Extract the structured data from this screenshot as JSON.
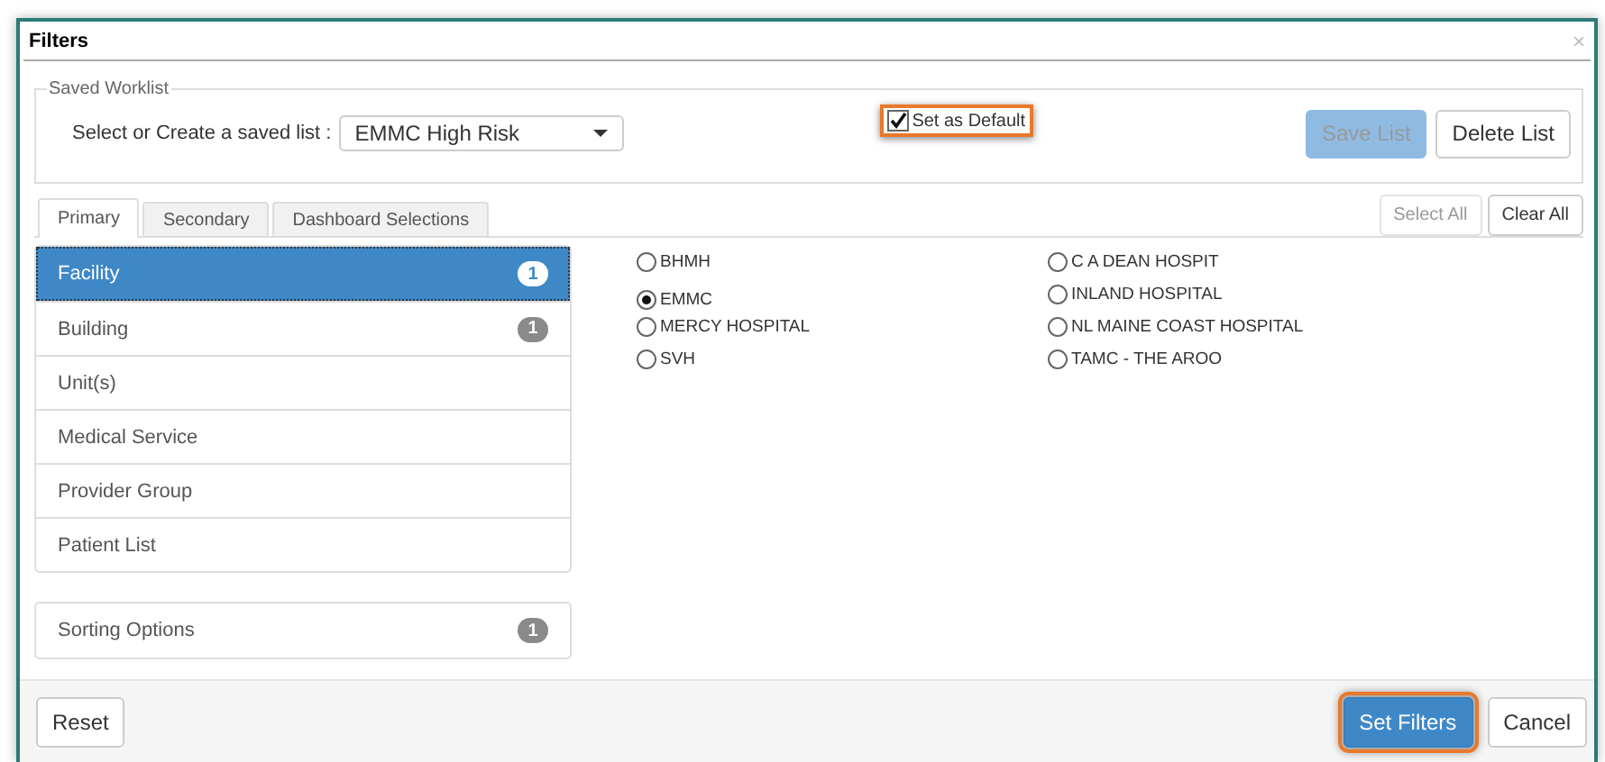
{
  "dialog": {
    "title": "Filters",
    "close": "×"
  },
  "saved_worklist": {
    "legend": "Saved Worklist",
    "label": "Select or Create a saved list :",
    "value": "EMMC High Risk",
    "set_default": {
      "label": "Set as Default",
      "checked": true,
      "highlighted": true
    },
    "buttons": [
      {
        "label": "Save List",
        "kind": "primary",
        "disabled": true
      },
      {
        "label": "Delete List",
        "kind": "default",
        "disabled": false
      }
    ]
  },
  "tabs": [
    {
      "label": "Primary",
      "selected": true
    },
    {
      "label": "Secondary",
      "selected": false
    },
    {
      "label": "Dashboard Selections",
      "selected": false
    }
  ],
  "tab_buttons": [
    {
      "label": "Select All",
      "disabled": true
    },
    {
      "label": "Clear All",
      "disabled": false
    }
  ],
  "categories": [
    {
      "label": "Facility",
      "badge": "1",
      "selected": true
    },
    {
      "label": "Building",
      "badge": "1",
      "selected": false
    },
    {
      "label": "Unit(s)",
      "selected": false
    },
    {
      "label": "Medical Service",
      "selected": false
    },
    {
      "label": "Provider Group",
      "selected": false
    },
    {
      "label": "Patient List",
      "selected": false
    }
  ],
  "sorting": {
    "label": "Sorting Options",
    "badge": "1"
  },
  "option_columns": [
    [
      {
        "label": "BHMH",
        "selected": false
      },
      {
        "label": "EMMC",
        "selected": true
      },
      {
        "label": "MERCY HOSPITAL",
        "selected": false
      },
      {
        "label": "SVH",
        "selected": false
      }
    ],
    [
      {
        "label": "C A DEAN HOSPIT",
        "selected": false
      },
      {
        "label": "INLAND HOSPITAL",
        "selected": false
      },
      {
        "label": "NL MAINE COAST HOSPITAL",
        "selected": false
      },
      {
        "label": "TAMC - THE AROO",
        "selected": false
      }
    ]
  ],
  "footer": {
    "buttons": [
      {
        "label": "Reset",
        "kind": "default",
        "highlighted": false
      },
      {
        "label": "Set Filters",
        "kind": "primary",
        "highlighted": true
      },
      {
        "label": "Cancel",
        "kind": "default",
        "highlighted": false
      }
    ]
  }
}
